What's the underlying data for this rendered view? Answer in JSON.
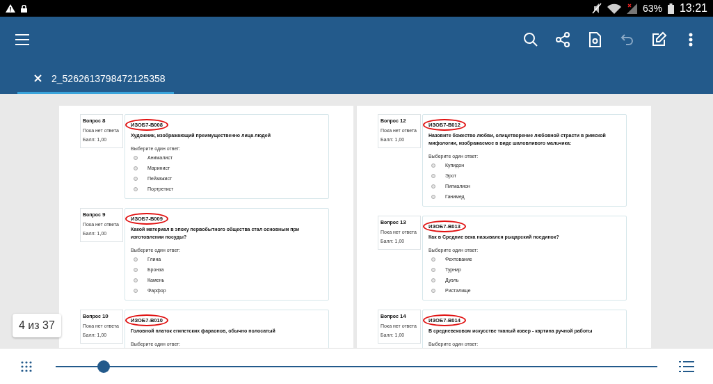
{
  "status_bar": {
    "battery": "63%",
    "time": "13:21"
  },
  "toolbar": {
    "undo_disabled": true
  },
  "tabs": [
    {
      "label": "2_5262613798472125358",
      "selected": true
    }
  ],
  "pages": [
    {
      "questions": [
        {
          "label": "Вопрос",
          "number": "8",
          "status": "Пока нет ответа",
          "score": "Балл: 1,00",
          "code": "ИЗОБ7-В008",
          "text": "Художник, изображающий преимущественно лица людей",
          "prompt": "Выберите один ответ:",
          "options": [
            {
              "label": "Анималист",
              "selected": false
            },
            {
              "label": "Маринист",
              "selected": false
            },
            {
              "label": "Пейзажист",
              "selected": false
            },
            {
              "label": "Портретист",
              "selected": false
            }
          ]
        },
        {
          "label": "Вопрос",
          "number": "9",
          "status": "Пока нет ответа",
          "score": "Балл: 1,00",
          "code": "ИЗОБ7-В009",
          "text": "Какой материал в эпоху первобытного общества стал основным при изготовлении посуды?",
          "prompt": "Выберите один ответ:",
          "options": [
            {
              "label": "Глина",
              "selected": false
            },
            {
              "label": "Бронза",
              "selected": false
            },
            {
              "label": "Камень",
              "selected": false
            },
            {
              "label": "Фарфор",
              "selected": false
            }
          ]
        },
        {
          "label": "Вопрос",
          "number": "10",
          "status": "Пока нет ответа",
          "score": "Балл: 1,00",
          "code": "ИЗОБ7-В010",
          "text": "Головной платок египетских фараонов, обычно полосатый",
          "prompt": "Выберите один ответ:"
        }
      ]
    },
    {
      "questions": [
        {
          "label": "Вопрос",
          "number": "12",
          "status": "Пока нет ответа",
          "score": "Балл: 1,00",
          "code": "ИЗОБ7-В012",
          "text": "Назовите божество любви, олицетворение любовной страсти в римской мифологии, изображаемое в виде шаловливого мальчика:",
          "prompt": "Выберите один ответ:",
          "options": [
            {
              "label": "Купидон",
              "selected": false
            },
            {
              "label": "Эрот",
              "selected": false
            },
            {
              "label": "Пигмалион",
              "selected": false
            },
            {
              "label": "Ганимед",
              "selected": false
            }
          ]
        },
        {
          "label": "Вопрос",
          "number": "13",
          "status": "Пока нет ответа",
          "score": "Балл: 1,00",
          "code": "ИЗОБ7-В013",
          "text": "Как в Средние века назывался рыцарский поединок?",
          "prompt": "Выберите один ответ:",
          "options": [
            {
              "label": "Фехтование",
              "selected": false
            },
            {
              "label": "Турнир",
              "selected": false
            },
            {
              "label": "Дуэль",
              "selected": false
            },
            {
              "label": "Ристалище",
              "selected": false
            }
          ]
        },
        {
          "label": "Вопрос",
          "number": "14",
          "status": "Пока нет ответа",
          "score": "Балл: 1,00",
          "code": "ИЗОБ7-В014",
          "text": "В средневековом искусстве тканый ковер - картина ручной работы",
          "prompt": "Выберите один ответ:"
        }
      ]
    }
  ],
  "page_counter": "4 из 37",
  "scrubber": {
    "level": 0.08
  }
}
